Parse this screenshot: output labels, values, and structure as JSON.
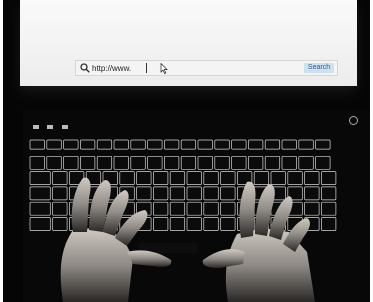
{
  "browser": {
    "url_text": "http://www.",
    "search_label": "Search",
    "search_button_color": "#cfe0ee"
  },
  "scene": {
    "screen_color": "#f5f5f5",
    "background_color": "#050505",
    "icons": [
      "search-icon",
      "mouse-cursor-icon",
      "power-icon"
    ]
  }
}
